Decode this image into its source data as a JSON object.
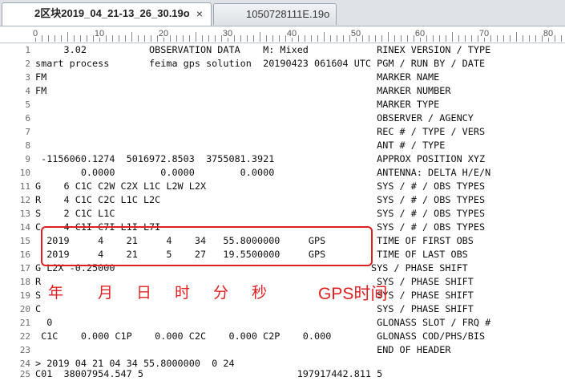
{
  "tabs": [
    {
      "label": "2区块2019_04_21-13_26_30.19o",
      "close": "×"
    },
    {
      "label": "1050728111E.19o"
    }
  ],
  "ruler": {
    "numbers": [
      "0",
      "10",
      "20",
      "30",
      "40",
      "50",
      "60",
      "70",
      "80"
    ]
  },
  "lines": [
    {
      "n": "1",
      "text": "     3.02           OBSERVATION DATA    M: Mixed            RINEX VERSION / TYPE"
    },
    {
      "n": "2",
      "text": "smart process       feima gps solution  20190423 061604 UTC PGM / RUN BY / DATE"
    },
    {
      "n": "3",
      "text": "FM                                                          MARKER NAME"
    },
    {
      "n": "4",
      "text": "FM                                                          MARKER NUMBER"
    },
    {
      "n": "5",
      "text": "                                                            MARKER TYPE"
    },
    {
      "n": "6",
      "text": "                                                            OBSERVER / AGENCY"
    },
    {
      "n": "7",
      "text": "                                                            REC # / TYPE / VERS"
    },
    {
      "n": "8",
      "text": "                                                            ANT # / TYPE"
    },
    {
      "n": "9",
      "text": " -1156060.1274  5016972.8503  3755081.3921                  APPROX POSITION XYZ"
    },
    {
      "n": "10",
      "text": "        0.0000        0.0000        0.0000                  ANTENNA: DELTA H/E/N"
    },
    {
      "n": "11",
      "text": "G    6 C1C C2W C2X L1C L2W L2X                              SYS / # / OBS TYPES"
    },
    {
      "n": "12",
      "text": "R    4 C1C C2C L1C L2C                                      SYS / # / OBS TYPES"
    },
    {
      "n": "13",
      "text": "S    2 C1C L1C                                              SYS / # / OBS TYPES"
    },
    {
      "n": "14",
      "text": "C    4 C1I C7I L1I L7I                                      SYS / # / OBS TYPES"
    },
    {
      "n": "15",
      "text": "  2019     4    21     4    34   55.8000000     GPS         TIME OF FIRST OBS"
    },
    {
      "n": "16",
      "text": "  2019     4    21     5    27   19.5500000     GPS         TIME OF LAST OBS"
    },
    {
      "n": "17",
      "text": "G L2X -0.25000                                             SYS / PHASE SHIFT"
    },
    {
      "n": "18",
      "text": "R                                                           SYS / PHASE SHIFT"
    },
    {
      "n": "19",
      "text": "S                                                           SYS / PHASE SHIFT"
    },
    {
      "n": "20",
      "text": "C                                                           SYS / PHASE SHIFT"
    },
    {
      "n": "21",
      "text": "  0                                                         GLONASS SLOT / FRQ #"
    },
    {
      "n": "22",
      "text": " C1C    0.000 C1P    0.000 C2C    0.000 C2P    0.000        GLONASS COD/PHS/BIS"
    },
    {
      "n": "23",
      "text": "                                                            END OF HEADER"
    },
    {
      "n": "24",
      "text": "> 2019 04 21 04 34 55.8000000  0 24"
    },
    {
      "n": "25",
      "text": "C01  38007954.547 5                           197917442.811 5"
    }
  ],
  "annotations": {
    "year": "年",
    "month": "月",
    "day": "日",
    "hour": "时",
    "minute": "分",
    "second": "秒",
    "gps_time": "GPS时间"
  },
  "colors": {
    "highlight": "#e02020",
    "tab_active_bg": "#ffffff",
    "tabbar_bg": "#dfe3e8"
  }
}
